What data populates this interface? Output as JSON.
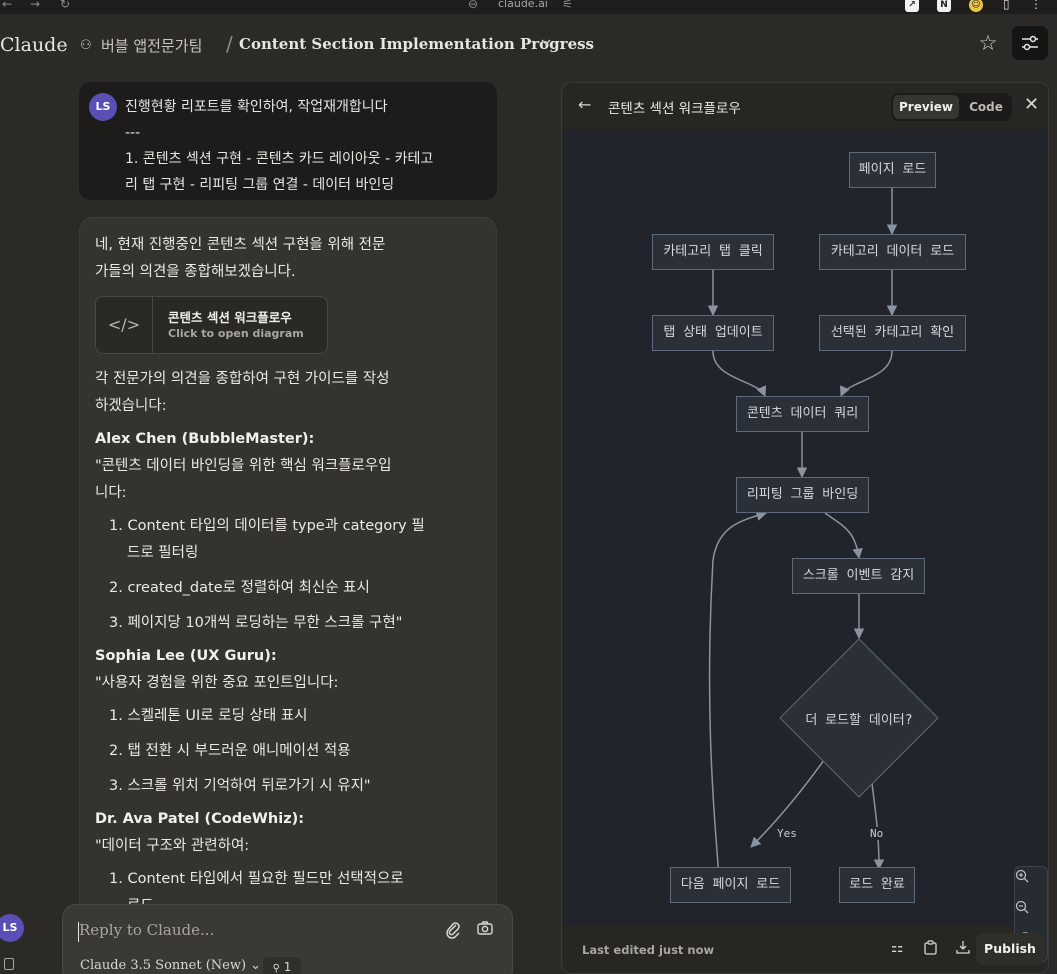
{
  "browser": {
    "url": "claude.ai",
    "back_icon": "arrow-left-icon",
    "forward_icon": "arrow-right-icon",
    "reload_icon": "reload-icon"
  },
  "header": {
    "brand": "Claude",
    "project_name": "버블 앱전문가팀",
    "separator": "/",
    "conversation_title": "Content Section Implementation Progress",
    "caret": "⌄"
  },
  "user_message": {
    "avatar": "LS",
    "lines": [
      "진행현황 리포트를 확인하여, 작업재개합니다",
      "---",
      "1. 콘텐츠 섹션 구현 - 콘텐츠 카드 레이아웃 - 카테고",
      "리 탭 구현 - 리피팅 그룹 연결 - 데이터 바인딩"
    ]
  },
  "assistant_message": {
    "intro_lines": [
      "네, 현재 진행중인 콘텐츠 섹션 구현을 위해 전문",
      "가들의 의견을 종합해보겠습니다."
    ],
    "artifact_card": {
      "title": "콘텐츠 섹션 워크플로우",
      "subtitle": "Click to open diagram",
      "icon": "</>"
    },
    "guide_lines": [
      "각 전문가의 의견을 종합하여 구현 가이드를 작성",
      "하겠습니다:"
    ],
    "experts": [
      {
        "name": "Alex Chen (BubbleMaster):",
        "quote_lines": [
          "\"콘텐츠 데이터 바인딩을 위한 핵심 워크플로우입",
          "니다:"
        ],
        "items": [
          [
            "1. Content 타입의 데이터를 type과 category 필",
            "드로 필터링"
          ],
          [
            "2. created_date로 정렬하여 최신순 표시"
          ],
          [
            "3. 페이지당 10개씩 로딩하는 무한 스크롤 구현\""
          ]
        ]
      },
      {
        "name": "Sophia Lee (UX Guru):",
        "quote_lines": [
          "\"사용자 경험을 위한 중요 포인트입니다:"
        ],
        "items": [
          [
            "1. 스켈레톤 UI로 로딩 상태 표시"
          ],
          [
            "2. 탭 전환 시 부드러운 애니메이션 적용"
          ],
          [
            "3. 스크롤 위치 기억하여 뒤로가기 시 유지\""
          ]
        ]
      },
      {
        "name": "Dr. Ava Patel (CodeWhiz):",
        "quote_lines": [
          "\"데이터 구조와 관련하여:"
        ],
        "items": [
          [
            "1. Content 타입에서 필요한 필드만 선택적으로",
            "로드"
          ]
        ]
      }
    ]
  },
  "reply": {
    "placeholder": "Reply to Claude...",
    "model": "Claude 3.5 Sonnet (New) ⌄",
    "badge": "1"
  },
  "sidebar": {
    "avatar": "LS"
  },
  "panel": {
    "title": "콘텐츠 섹션 워크플로우",
    "tab_preview": "Preview",
    "tab_code": "Code",
    "last_edited": "Last edited just now",
    "publish": "Publish"
  },
  "diagram": {
    "nodes": {
      "page_load": "페이지 로드",
      "category_tab_click": "카테고리 탭 클릭",
      "category_data_load": "카테고리 데이터 로드",
      "tab_state_update": "탭 상태 업데이트",
      "selected_category_check": "선택된 카테고리 확인",
      "content_data_query": "콘텐츠 데이터 쿼리",
      "repeating_group_binding": "리피팅 그룹 바인딩",
      "scroll_event_detect": "스크롤 이벤트 감지",
      "more_data_decision": "더 로드할 데이터?",
      "next_page_load": "다음 페이지 로드",
      "load_complete": "로드 완료"
    },
    "edge_labels": {
      "yes": "Yes",
      "no": "No"
    }
  },
  "colors": {
    "background": "#2b2a27",
    "panel_background": "#21252b",
    "node_border": "#5f6a7a",
    "edge": "#8a93a0",
    "avatar": "#5a4fb5"
  }
}
